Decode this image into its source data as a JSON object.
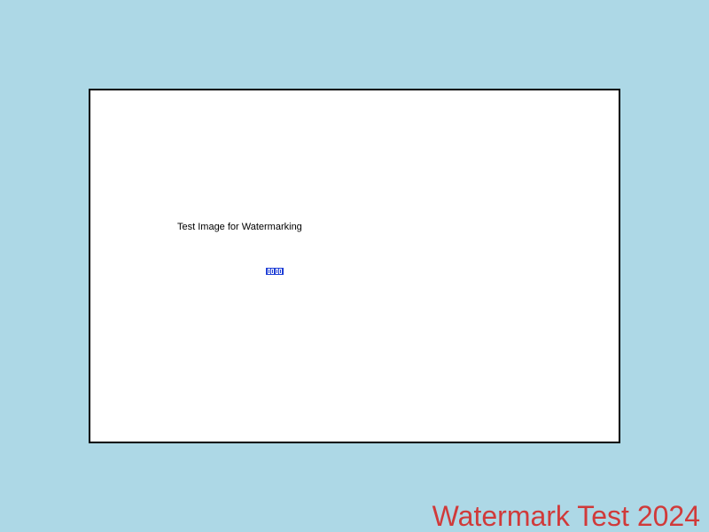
{
  "caption": "Test Image for Watermarking",
  "glyph_box": {
    "color": "#1f3fd6",
    "count": 4
  },
  "watermark": {
    "text": "Watermark Test 2024",
    "color": "#d03a3a"
  },
  "colors": {
    "page_background": "#add8e6",
    "canvas_background": "#ffffff",
    "canvas_border": "#000000"
  }
}
